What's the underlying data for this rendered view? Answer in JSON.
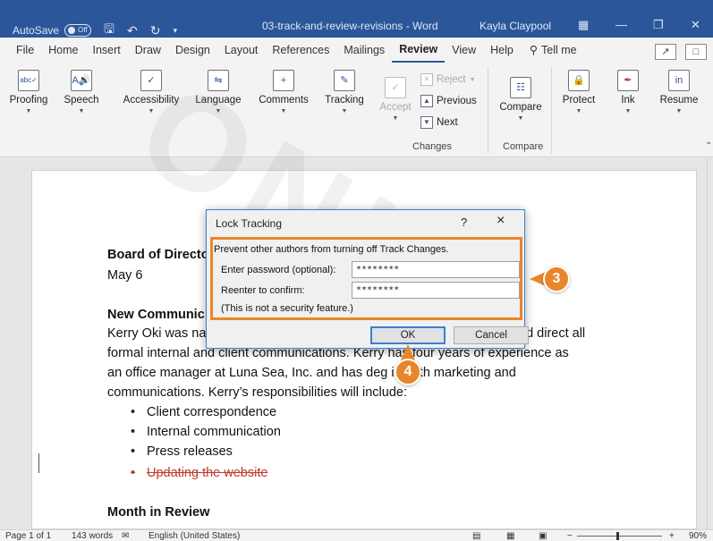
{
  "titlebar": {
    "autosave_label": "AutoSave",
    "autosave_state": "Off",
    "document_title": "03-track-and-review-revisions - Word",
    "user": "Kayla Claypool"
  },
  "tabs": [
    "File",
    "Home",
    "Insert",
    "Draw",
    "Design",
    "Layout",
    "References",
    "Mailings",
    "Review",
    "View",
    "Help"
  ],
  "active_tab": "Review",
  "tell_me": "Tell me",
  "ribbon": {
    "proofing": "Proofing",
    "speech": "Speech",
    "accessibility": "Accessibility",
    "language": "Language",
    "comments": "Comments",
    "tracking": "Tracking",
    "accept": "Accept",
    "reject": "Reject",
    "previous": "Previous",
    "next": "Next",
    "changes_group": "Changes",
    "compare": "Compare",
    "compare_group": "Compare",
    "protect": "Protect",
    "ink": "Ink",
    "resume": "Resume"
  },
  "document": {
    "heading1": "Board of Directo",
    "date": "May 6",
    "heading2": "New Communic",
    "para_line1_left": "Kerry Oki was na",
    "para_line1_right": "nd direct all",
    "para_line2": "formal internal and client communications. Kerry has four years of experience as",
    "para_line3": "an office manager at Luna Sea, Inc. and has deg   in both marketing and",
    "para_line4": "communications. Kerry’s responsibilities will include:",
    "bullets": [
      "Client correspondence",
      "Internal communication",
      "Press releases"
    ],
    "deleted_bullet": "Updating the website",
    "heading3": "Month in Review"
  },
  "dialog": {
    "title": "Lock Tracking",
    "help": "?",
    "close": "×",
    "description": "Prevent other authors from turning off Track Changes.",
    "password_label": "Enter password (optional):",
    "password_value": "********",
    "confirm_label": "Reenter to confirm:",
    "confirm_value": "********",
    "note": "(This is not a security feature.)",
    "ok": "OK",
    "cancel": "Cancel"
  },
  "callouts": {
    "step3": "3",
    "step4": "4"
  },
  "watermark": "ONLY",
  "status": {
    "page": "Page 1 of 1",
    "words": "143 words",
    "language": "English (United States)",
    "zoom": "90%",
    "zoom_minus": "−",
    "zoom_plus": "+"
  },
  "colors": {
    "accent": "#2b579a",
    "callout": "#e8862a",
    "deletion": "#c0392b"
  }
}
